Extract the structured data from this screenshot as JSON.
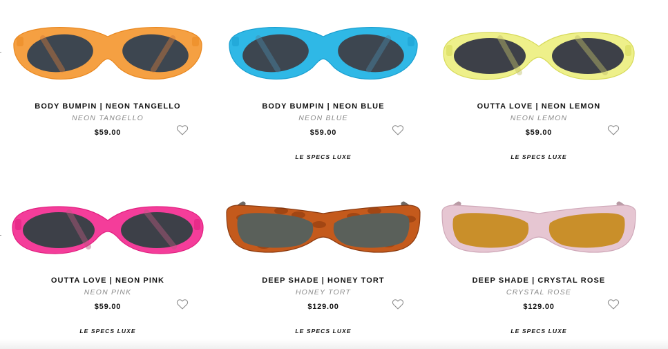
{
  "products": [
    {
      "title": "BODY BUMPIN | NEON TANGELLO",
      "colorway": "NEON TANGELLO",
      "price": "$59.00",
      "brand": "",
      "frame_color": "#f5a042",
      "frame_edge": "#e98820",
      "lens_color": "#3d4650",
      "arm_color": "#cf7a3a",
      "shape": "cat-eye",
      "wishlist_icon": "heart-outline-icon"
    },
    {
      "title": "BODY BUMPIN | NEON BLUE",
      "colorway": "NEON BLUE",
      "price": "$59.00",
      "brand": "LE SPECS LUXE",
      "frame_color": "#2fb8e6",
      "frame_edge": "#1a9fd0",
      "lens_color": "#3d4650",
      "arm_color": "#4a86a8",
      "shape": "cat-eye",
      "wishlist_icon": "heart-outline-icon"
    },
    {
      "title": "OUTTA LOVE | NEON LEMON",
      "colorway": "NEON LEMON",
      "price": "$59.00",
      "brand": "LE SPECS LUXE",
      "frame_color": "#eef08a",
      "frame_edge": "#d7da5a",
      "lens_color": "#3d4048",
      "arm_color": "#c0bf6a",
      "shape": "oval",
      "wishlist_icon": "heart-outline-icon"
    },
    {
      "title": "OUTTA LOVE | NEON PINK",
      "colorway": "NEON PINK",
      "price": "$59.00",
      "brand": "LE SPECS LUXE",
      "frame_color": "#f43d9a",
      "frame_edge": "#e0207f",
      "lens_color": "#3d4048",
      "arm_color": "#b85a7e",
      "shape": "oval",
      "wishlist_icon": "heart-outline-icon"
    },
    {
      "title": "DEEP SHADE | HONEY TORT",
      "colorway": "HONEY TORT",
      "price": "$129.00",
      "brand": "LE SPECS LUXE",
      "frame_color": "#c45a1c",
      "frame_edge": "#8a3a10",
      "lens_color": "#5a605a",
      "arm_color": "#6e6a66",
      "shape": "rect",
      "wishlist_icon": "heart-outline-icon"
    },
    {
      "title": "DEEP SHADE | CRYSTAL ROSE",
      "colorway": "CRYSTAL ROSE",
      "price": "$129.00",
      "brand": "LE SPECS LUXE",
      "frame_color": "#e6c6d2",
      "frame_edge": "#cfa8b8",
      "lens_color": "#c98f2a",
      "arm_color": "#b89aa4",
      "shape": "rect",
      "wishlist_icon": "heart-outline-icon"
    }
  ]
}
